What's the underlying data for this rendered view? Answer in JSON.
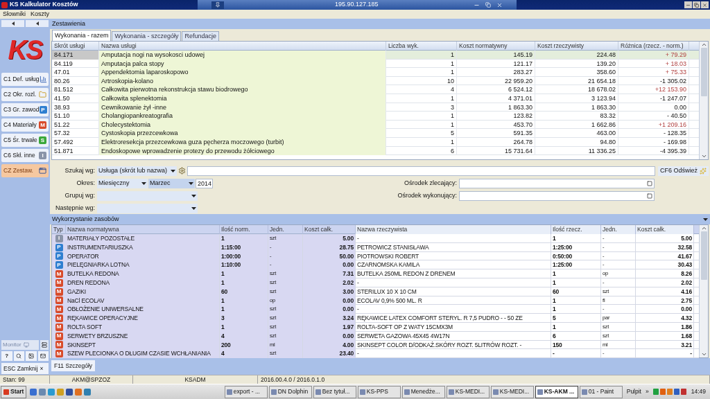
{
  "window": {
    "title": "KS Kalkulator Kosztów",
    "remote_host": "195.90.127.185"
  },
  "menu": [
    "Słowniki",
    "Koszty"
  ],
  "sidebar": {
    "logo": "KS",
    "items": [
      {
        "label": "C1 Def. usług",
        "selected": false,
        "kind": "chart"
      },
      {
        "label": "C2 Okr. rozl.",
        "selected": false,
        "kind": "folder"
      },
      {
        "label": "C3 Gr. zawod",
        "selected": false,
        "kind": "letter",
        "letter": "P",
        "color": "#2f7fd0"
      },
      {
        "label": "C4 Materiały",
        "selected": false,
        "kind": "letter",
        "letter": "M",
        "color": "#d84a2a"
      },
      {
        "label": "C5 Śr. trwałe",
        "selected": false,
        "kind": "letter",
        "letter": "S",
        "color": "#3aa83a"
      },
      {
        "label": "C6 Skł. inne",
        "selected": false,
        "kind": "letter",
        "letter": "I",
        "color": "#8a94a8"
      },
      {
        "label": "CZ Zestaw.",
        "selected": true,
        "kind": "window"
      }
    ],
    "monitor": "Monitor",
    "help": "?",
    "close": {
      "label": "ESC Zamknij",
      "mark": "×"
    }
  },
  "panel_title": "Zestawienia",
  "tabs": [
    {
      "label": "Wykonania - razem",
      "selected": true
    },
    {
      "label": "Wykonania - szczegóły",
      "selected": false
    },
    {
      "label": "Refundacje",
      "selected": false
    }
  ],
  "top_table": {
    "columns": [
      "Skrót usługi",
      "Nazwa usługi",
      "Liczba wyk.",
      "Koszt normatywny",
      "Koszt rzeczywisty",
      "Różnica (rzecz. - norm.)"
    ],
    "rows": [
      {
        "cells": [
          "84.171",
          "Amputacja nogi na wysokosci udowej",
          "1",
          "145.19",
          "224.48",
          "+ 79.29"
        ],
        "over": true,
        "selected": true
      },
      {
        "cells": [
          "84.119",
          "Amputacja palca stopy",
          "1",
          "121.17",
          "139.20",
          "+ 18.03"
        ],
        "over": true,
        "selected": false
      },
      {
        "cells": [
          "47.01",
          "Appendektomia laparoskopowo",
          "1",
          "283.27",
          "358.60",
          "+ 75.33"
        ],
        "over": true,
        "selected": false
      },
      {
        "cells": [
          "80.26",
          "Artroskopia-kolano",
          "10",
          "22 959.20",
          "21 654.18",
          "-1 305.02"
        ],
        "over": false,
        "selected": false
      },
      {
        "cells": [
          "81.512",
          "Całkowita pierwotna rekonstrukcja stawu biodrowego",
          "4",
          "6 524.12",
          "18 678.02",
          "+12 153.90"
        ],
        "over": true,
        "selected": false
      },
      {
        "cells": [
          "41.50",
          "Całkowita splenektomia",
          "1",
          "4 371.01",
          "3 123.94",
          "-1 247.07"
        ],
        "over": false,
        "selected": false
      },
      {
        "cells": [
          "38.93",
          "Cewnikowanie żył -inne",
          "3",
          "1 863.30",
          "1 863.30",
          "0.00"
        ],
        "over": false,
        "selected": false
      },
      {
        "cells": [
          "51.10",
          "Cholangiopankreatografia",
          "1",
          "123.82",
          "83.32",
          "- 40.50"
        ],
        "over": false,
        "selected": false
      },
      {
        "cells": [
          "51.22",
          "Cholecystektomia",
          "1",
          "453.70",
          "1 662.86",
          "+1 209.16"
        ],
        "over": true,
        "selected": false
      },
      {
        "cells": [
          "57.32",
          "Cystoskopia przezcewkowa",
          "5",
          "591.35",
          "463.00",
          "- 128.35"
        ],
        "over": false,
        "selected": false
      },
      {
        "cells": [
          "57.492",
          "Elektroresekcja przezcewkowa guza pęcherza moczowego (turbit)",
          "1",
          "264.78",
          "94.80",
          "- 169.98"
        ],
        "over": false,
        "selected": false
      },
      {
        "cells": [
          "51.871",
          "Endoskopowe wprowadzenie protezy do przewodu żółciowego",
          "6",
          "15 731.64",
          "11 336.25",
          "-4 395.39"
        ],
        "over": false,
        "selected": false
      }
    ]
  },
  "filters": {
    "search_label": "Szukaj wg:",
    "search_by": "Usługa (skrót lub nazwa)",
    "period_label": "Okres:",
    "period": "Miesięczny",
    "month": "Marzec",
    "year": "2014",
    "group_label": "Grupuj wg:",
    "then_label": "Następnie wg:",
    "ordering_label": "Ośrodek zlecający:",
    "executing_label": "Ośrodek wykonujący:",
    "refresh": "CF6 Odśwież"
  },
  "resources": {
    "title": "Wykorzystanie zasobów",
    "columns": [
      "Typ",
      "Nazwa normatywna",
      "Ilość norm.",
      "Jedn.",
      "Koszt całk.",
      "Nazwa rzeczywista",
      "Ilość rzecz.",
      "Jedn.",
      "Koszt całk."
    ],
    "rows": [
      {
        "kind": "other",
        "cells": [
          "I",
          "MATERIAŁY POZOSTAŁE",
          "1",
          "szt",
          "5.00",
          "-",
          "1",
          "-",
          "5.00"
        ]
      },
      {
        "kind": "staff",
        "cells": [
          "P",
          "INSTRUMENTARIUSZKA",
          "1:15:00",
          "-",
          "28.75",
          "PETROWICZ STANISŁAWA",
          "1:25:00",
          "-",
          "32.58"
        ]
      },
      {
        "kind": "staff",
        "cells": [
          "P",
          "OPERATOR",
          "1:00:00",
          "-",
          "50.00",
          "PIOTROWSKI ROBERT",
          "0:50:00",
          "-",
          "41.67"
        ]
      },
      {
        "kind": "staff",
        "cells": [
          "P",
          "PIELĘGNIARKA LOTNA",
          "1:10:00",
          "-",
          "0.00",
          "CZARNOMSKA KAMILA",
          "1:25:00",
          "-",
          "30.43"
        ]
      },
      {
        "kind": "material",
        "cells": [
          "M",
          "BUTELKA REDONA",
          "1",
          "szt",
          "7.31",
          "BUTELKA 250ML REDON Z DRENEM",
          "1",
          "op",
          "8.26"
        ]
      },
      {
        "kind": "material",
        "cells": [
          "M",
          "DREN REDONA",
          "1",
          "szt",
          "2.02",
          "-",
          "1",
          "-",
          "2.02"
        ]
      },
      {
        "kind": "material",
        "cells": [
          "M",
          "GAZIKI",
          "60",
          "szt",
          "3.00",
          "STERILUX 10 X 10 CM",
          "60",
          "szt",
          "4.16"
        ]
      },
      {
        "kind": "material",
        "cells": [
          "M",
          "NaCl ECOLAV",
          "1",
          "op",
          "0.00",
          "ECOLAV 0,9% 500 ML. R",
          "1",
          "fl",
          "2.75"
        ]
      },
      {
        "kind": "material",
        "cells": [
          "M",
          "OBŁOŻENIE UNIWERSALNE",
          "1",
          "szt",
          "0.00",
          "-",
          "1",
          "-",
          "0.00"
        ]
      },
      {
        "kind": "material",
        "cells": [
          "M",
          "RĘKAWICE OPERACYJNE",
          "3",
          "szt",
          "3.24",
          "RĘKAWICE LATEX COMFORT STERYL. R 7,5 PUDRO - - 50 ZE",
          "5",
          "par",
          "4.32"
        ]
      },
      {
        "kind": "material",
        "cells": [
          "M",
          "ROLTA SOFT",
          "1",
          "szt",
          "1.97",
          "ROLTA-SOFT OP Z WATY 15CMX3M",
          "1",
          "szt",
          "1.86"
        ]
      },
      {
        "kind": "material",
        "cells": [
          "M",
          "SERWETY BRZUSZNE",
          "4",
          "szt",
          "0.00",
          "SERWETA GAZOWA 45X45 4W17N",
          "6",
          "szt",
          "1.68"
        ]
      },
      {
        "kind": "material",
        "cells": [
          "M",
          "SKINSEPT",
          "200",
          "ml",
          "4.00",
          "SKINSEPT COLOR D/ODKAŻ.SKÓRY ROZT. 5LITRÓW ROZT. -",
          "150",
          "ml",
          "3.21"
        ]
      },
      {
        "kind": "material",
        "cells": [
          "M",
          "SZEW PLECIONKA O DŁUGIM CZASIE WCHŁANIANIA",
          "4",
          "szt",
          "23.40",
          "-",
          "-",
          "-",
          "-"
        ]
      }
    ]
  },
  "bottom_tab": "F11 Szczegóły",
  "status_bar": [
    "Stan: 99",
    "AKM@SPZOZ",
    "KSADM",
    "2016.00.4.0 / 2016.0.1.0"
  ],
  "taskbar": {
    "start": "Start",
    "tasks": [
      {
        "label": "export - ...",
        "selected": false
      },
      {
        "label": "DN Dolphin",
        "selected": false
      },
      {
        "label": "Bez tytuł...",
        "selected": false
      },
      {
        "label": "KS-PPS",
        "selected": false
      },
      {
        "label": "Menedże...",
        "selected": false
      },
      {
        "label": "KS-MEDI...",
        "selected": false
      },
      {
        "label": "KS-MEDI...",
        "selected": false
      },
      {
        "label": "KS-AKM ...",
        "selected": true
      },
      {
        "label": "01 - Paint",
        "selected": false
      }
    ],
    "desktop": "Pulpit",
    "more": "»",
    "clock": "14:49"
  }
}
